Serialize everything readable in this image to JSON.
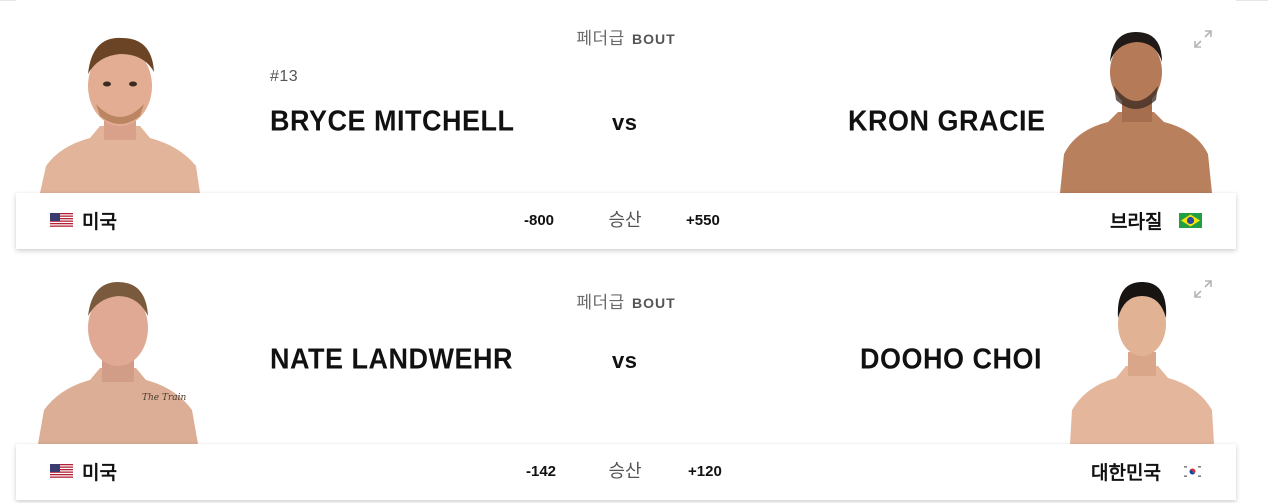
{
  "bouts": [
    {
      "weight_class": "페더급",
      "bout_label": "BOUT",
      "red": {
        "rank": "#13",
        "name": "BRYCE MITCHELL",
        "country": "미국",
        "flag": "us-flag-icon",
        "odds": "-800"
      },
      "vs_label": "vs",
      "blue": {
        "name": "KRON GRACIE",
        "country": "브라질",
        "flag": "brazil-flag-icon",
        "odds": "+550"
      },
      "odds_label": "승산"
    },
    {
      "weight_class": "페더급",
      "bout_label": "BOUT",
      "red": {
        "rank": "",
        "name": "NATE LANDWEHR",
        "country": "미국",
        "flag": "us-flag-icon",
        "odds": "-142"
      },
      "vs_label": "vs",
      "blue": {
        "name": "DOOHO CHOI",
        "country": "대한민국",
        "flag": "korea-flag-icon",
        "odds": "+120"
      },
      "odds_label": "승산"
    }
  ],
  "colors": {
    "text": "#111111",
    "muted": "#6b6b6b",
    "skin": "#d9a78a",
    "hair": "#5a3a22"
  }
}
